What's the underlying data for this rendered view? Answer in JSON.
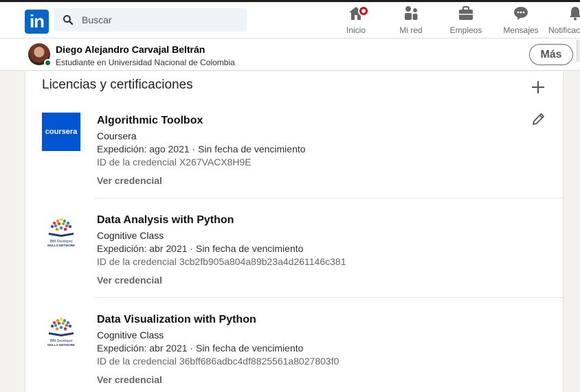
{
  "topbar": {
    "logo_text": "in",
    "search_placeholder": "Buscar",
    "nav": [
      {
        "label": "Inicio",
        "icon": "home-icon"
      },
      {
        "label": "Mi red",
        "icon": "network-icon"
      },
      {
        "label": "Empleos",
        "icon": "briefcase-icon"
      },
      {
        "label": "Mensajes",
        "icon": "messaging-icon"
      },
      {
        "label": "Notificac",
        "icon": "bell-icon"
      }
    ]
  },
  "profile": {
    "name": "Diego Alejandro Carvajal Beltrán",
    "headline": "Estudiante en Universidad Nacional de Colombia",
    "more_label": "Más"
  },
  "section": {
    "title": "Licencias y certificaciones"
  },
  "certifications": [
    {
      "name": "Algorithmic Toolbox",
      "issuer": "Coursera",
      "logo_text": "coursera",
      "date": "Expedición: ago 2021 · Sin fecha de vencimiento",
      "credential_id": "ID de la credencial X267VACX8H9E",
      "link": "Ver credencial"
    },
    {
      "name": "Data Analysis with Python",
      "issuer": "Cognitive Class",
      "logo_text": "IBM Developer SKILLS NETWORK",
      "date": "Expedición: abr 2021 · Sin fecha de vencimiento",
      "credential_id": "ID de la credencial 3cb2fb905a804a89b23a4d261146c381",
      "link": "Ver credencial"
    },
    {
      "name": "Data Visualization with Python",
      "issuer": "Cognitive Class",
      "logo_text": "IBM Developer SKILLS NETWORK",
      "date": "Expedición: abr 2021 · Sin fecha de vencimiento",
      "credential_id": "ID de la credencial 36bff686adbc4df8825561a8027803f0",
      "link": "Ver credencial"
    }
  ],
  "colors": {
    "brand": "#0a66c2",
    "coursera": "#0056d2",
    "badge": "#cc1016",
    "online": "#057642"
  }
}
